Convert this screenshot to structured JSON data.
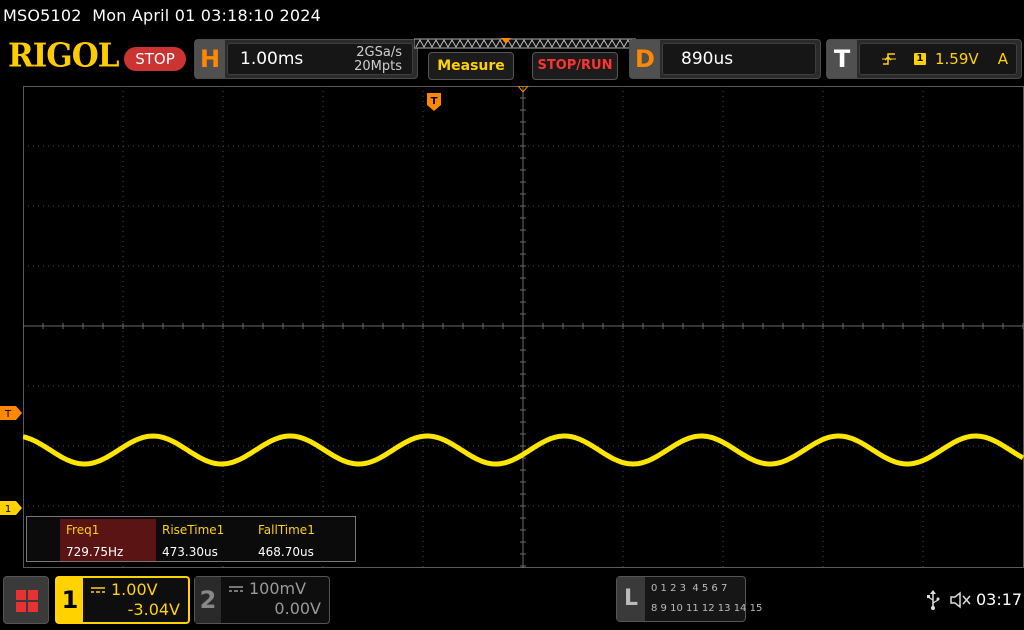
{
  "header": {
    "model": "MSO5102",
    "datetime": "Mon April 01 03:18:10 2024"
  },
  "topbar": {
    "logo": "RIGOL",
    "run_state": "STOP",
    "horizontal": {
      "key": "H",
      "timebase": "1.00ms",
      "sample_rate": "2GSa/s",
      "memory_depth": "20Mpts"
    },
    "measure_label": "Measure",
    "stoprun_label": "STOP/RUN",
    "delay": {
      "key": "D",
      "value": "890us"
    },
    "trigger": {
      "key": "T",
      "source": "1",
      "level": "1.59V",
      "mode": "A"
    }
  },
  "markers": {
    "trigger_level": "T",
    "ch1_ground": "1"
  },
  "measurements": [
    {
      "name": "Freq1",
      "value": "729.75Hz"
    },
    {
      "name": "RiseTime1",
      "value": "473.30us"
    },
    {
      "name": "FallTime1",
      "value": "468.70us"
    }
  ],
  "channels": {
    "ch1": {
      "number": "1",
      "scale": "1.00V",
      "offset": "-3.04V",
      "color": "#ffd200"
    },
    "ch2": {
      "number": "2",
      "scale": "100mV",
      "offset": "0.00V",
      "color": "#9a9a9a"
    }
  },
  "logic_analyzer": {
    "key": "L",
    "row1": "0 1 2 3  4 5 6 7",
    "row2": "8 9 10 11 12 13 14 15"
  },
  "status": {
    "clock": "03:17",
    "usb_icon": "usb-icon",
    "sound_icon": "speaker-muted-icon"
  },
  "waveform": {
    "channel": "1",
    "color": "#ffe600",
    "shape": "sine",
    "cycles_on_screen": 7.3
  }
}
